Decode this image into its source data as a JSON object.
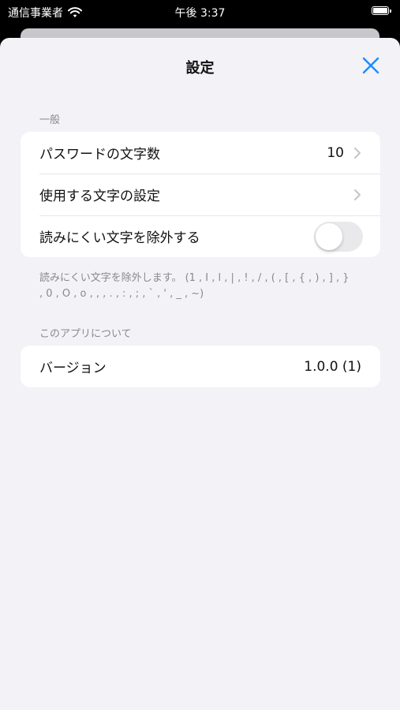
{
  "status_bar": {
    "carrier": "通信事業者",
    "time": "午後 3:37",
    "wifi_icon": "wifi-icon",
    "battery_icon": "battery-icon"
  },
  "nav": {
    "title": "設定",
    "close_icon": "close-icon",
    "accent_color": "#1a8cff"
  },
  "general": {
    "header": "一般",
    "password_length": {
      "label": "パスワードの文字数",
      "value": "10"
    },
    "characters": {
      "label": "使用する文字の設定"
    },
    "exclude_ambiguous": {
      "label": "読みにくい文字を除外する",
      "enabled": false
    },
    "footer": "読みにくい文字を除外します。 (1 , I , l , | , ! , / , ( , [ , { , ) , ] , } , 0 , O , o , , , . , : , ; , ` , ' , _ , ~)"
  },
  "about": {
    "header": "このアプリについて",
    "version": {
      "label": "バージョン",
      "value": "1.0.0 (1)"
    }
  }
}
